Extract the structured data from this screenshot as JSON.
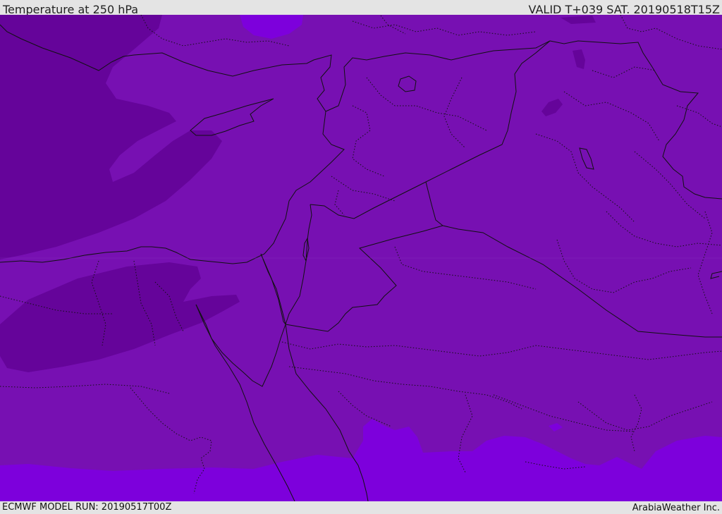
{
  "header": {
    "title": "Temperature at 250 hPa",
    "valid": "VALID T+039 SAT. 20190518T15Z"
  },
  "footer": {
    "model_run": "ECMWF MODEL RUN: 20190517T00Z",
    "credit": "ArabiaWeather Inc."
  },
  "map": {
    "colors": {
      "colder_band": "#65049a",
      "base_band": "#7710b2",
      "warmer_band": "#7d00dc",
      "coastline": "#111111",
      "border": "#111111"
    }
  }
}
